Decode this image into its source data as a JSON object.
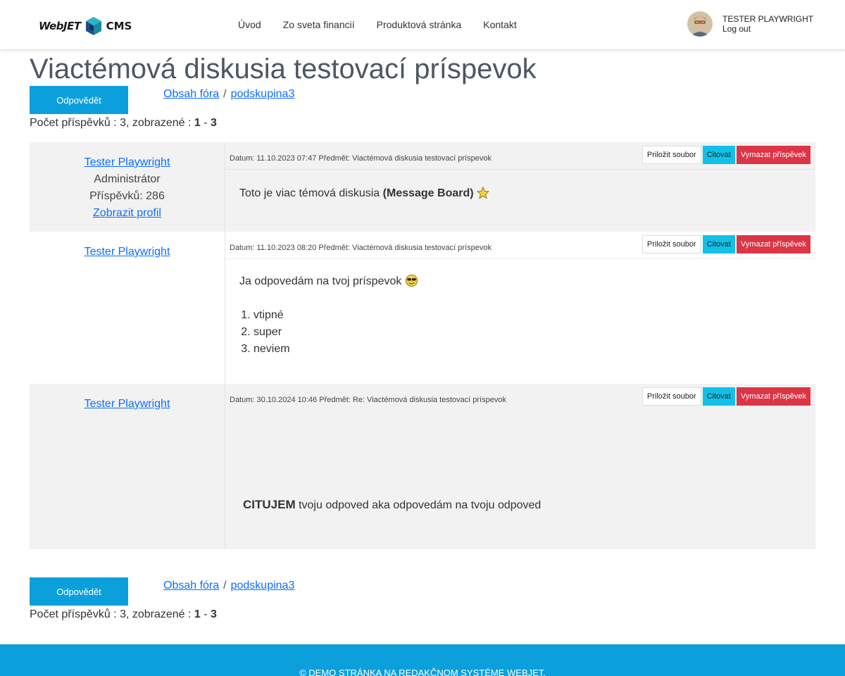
{
  "header": {
    "logo_left": "WebJET",
    "logo_right": "CMS",
    "nav": [
      "Úvod",
      "Zo sveta financií",
      "Produktová stránka",
      "Kontakt"
    ],
    "user_name": "TESTER PLAYWRIGHT",
    "logout": "Log out"
  },
  "page_title": "Viactémová diskusia testovací príspevok",
  "reply_label": "Odpovědět",
  "breadcrumb": {
    "forum": "Obsah fóra",
    "sep": "/",
    "group": "podskupina3"
  },
  "count": {
    "prefix": "Počet příspěvků : 3, zobrazené : ",
    "from": "1",
    "dash": " - ",
    "to": "3"
  },
  "actions": {
    "attach": "Priložit soubor",
    "quote": "Citovat",
    "delete": "Vymazat příspěvek"
  },
  "posts": [
    {
      "author": "Tester Playwright",
      "role": "Administrátor",
      "posts_count": "Příspěvků: 286",
      "profile": "Zobrazit profil",
      "meta": "Datum: 11.10.2023 07:47 Předmět: Viactémová diskusia testovací príspevok",
      "text": "Toto je viac témová diskusia ",
      "bold": "(Message Board)"
    },
    {
      "author": "Tester Playwright",
      "meta": "Datum: 11.10.2023 08:20 Předmět: Viactémová diskusia testovací príspevok",
      "text": "Ja odpovedám na tvoj príspevok",
      "list": [
        "vtipné",
        "super",
        "neviem"
      ]
    },
    {
      "author": "Tester Playwright",
      "meta": "Datum: 30.10.2024 10:46 Předmět: Re: Viactémová diskusia testovací príspevok",
      "bold": "CITUJEM",
      "text": " tvoju odpoved aka odpovedám na tvoju odpoved"
    }
  ],
  "footer": "© DEMO STRÁNKA NA REDAKČNOM SYSTÉME WEBJET."
}
